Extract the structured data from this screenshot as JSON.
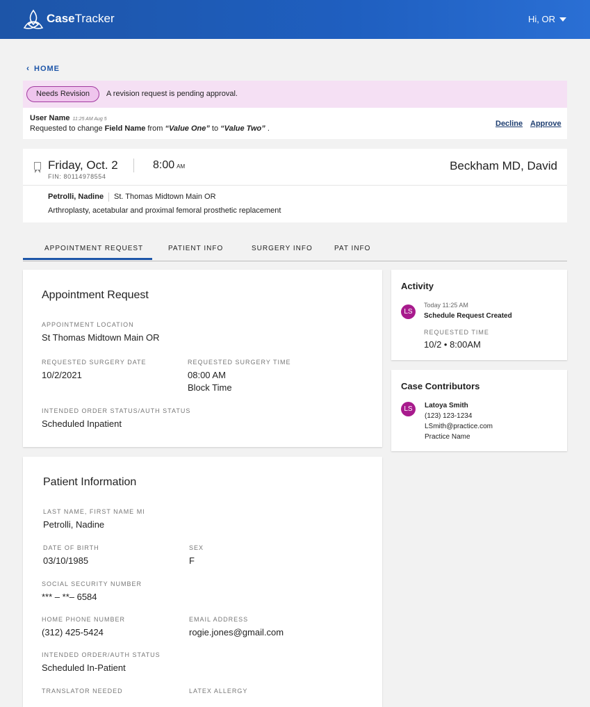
{
  "header": {
    "brand_bold": "Case",
    "brand_light": "Tracker",
    "greeting": "Hi, OR"
  },
  "nav": {
    "home_label": "HOME"
  },
  "revision": {
    "badge": "Needs Revision",
    "message": "A revision request is pending approval.",
    "user": "User Name",
    "timestamp": "11:25 AM Aug 5",
    "text_prefix": "Requested to change",
    "field": "Field Name",
    "from_word": "from",
    "old_value": "“Value One”",
    "to_word": "to",
    "new_value": "“Value Two”",
    "suffix": ".",
    "decline_label": "Decline",
    "approve_label": "Approve"
  },
  "case": {
    "date": "Friday, Oct. 2",
    "fin": "FIN: 80114978554",
    "time": "8:00",
    "time_suffix": "AM",
    "surgeon": "Beckham MD, David",
    "patient": "Petrolli, Nadine",
    "location": "St. Thomas Midtown Main OR",
    "procedure": "Arthroplasty, acetabular and proximal femoral prosthetic replacement"
  },
  "tabs": [
    {
      "label": "APPOINTMENT REQUEST"
    },
    {
      "label": "PATIENT INFO"
    },
    {
      "label": "SURGERY INFO"
    },
    {
      "label": "PAT INFO"
    }
  ],
  "appointment": {
    "title": "Appointment Request",
    "location_label": "APPOINTMENT LOCATION",
    "location_value": "St Thomas Midtown Main OR",
    "date_label": "REQUESTED SURGERY DATE",
    "date_value": "10/2/2021",
    "time_label": "REQUESTED SURGERY TIME",
    "time_value": "08:00 AM",
    "time_value2": "Block Time",
    "status_label": "INTENDED ORDER STATUS/AUTH STATUS",
    "status_value": "Scheduled Inpatient"
  },
  "patient_info": {
    "title": "Patient Information",
    "name_label": "LAST NAME, FIRST NAME MI",
    "name_value": "Petrolli, Nadine",
    "dob_label": "DATE OF BIRTH",
    "dob_value": "03/10/1985",
    "sex_label": "SEX",
    "sex_value": "F",
    "ssn_label": "SOCIAL SECURITY NUMBER",
    "ssn_value": "*** – **– 6584",
    "phone_label": "HOME PHONE NUMBER",
    "phone_value": "(312) 425-5424",
    "email_label": "EMAIL ADDRESS",
    "email_value": "rogie.jones@gmail.com",
    "order_label": "INTENDED ORDER/AUTH STATUS",
    "order_value": "Scheduled In-Patient",
    "translator_label": "TRANSLATOR NEEDED",
    "latex_label": "LATEX ALLERGY"
  },
  "activity": {
    "title": "Activity",
    "initials": "LS",
    "time": "Today 11:25 AM",
    "event": "Schedule Request Created",
    "req_label": "REQUESTED TIME",
    "req_value": "10/2 • 8:00AM"
  },
  "contributors": {
    "title": "Case Contributors",
    "initials": "LS",
    "name": "Latoya Smith",
    "phone": "(123) 123-1234",
    "email": "LSmith@practice.com",
    "practice": "Practice Name"
  },
  "colors": {
    "header_blue": "#1f5fc0",
    "badge_bg": "#efc5ed",
    "avatar": "#a81b8d",
    "link": "#1d3d70"
  }
}
